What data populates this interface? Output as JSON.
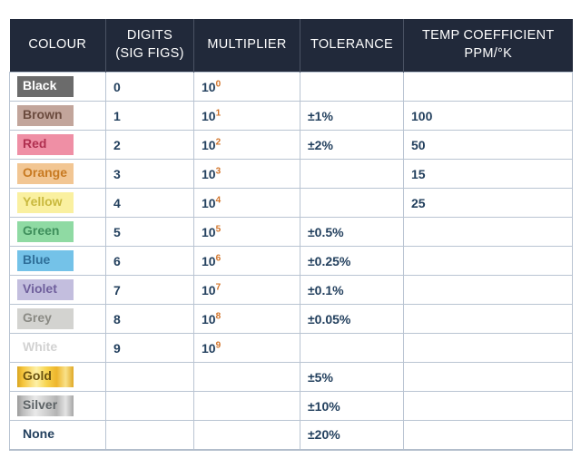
{
  "table": {
    "name": "resistor-colour-code-table",
    "headers": [
      {
        "line1": "COLOUR",
        "line2": ""
      },
      {
        "line1": "DIGITS",
        "line2": "(SIG FIGS)"
      },
      {
        "line1": "MULTIPLIER",
        "line2": ""
      },
      {
        "line1": "TOLERANCE",
        "line2": ""
      },
      {
        "line1": "TEMP COEFFICIENT",
        "line2": "PPM/°K"
      }
    ],
    "rows": [
      {
        "colour": "Black",
        "digits": "0",
        "mult_base": "10",
        "mult_exp": "0",
        "tolerance": "",
        "temp": "",
        "swatch_bg": "#6b6b6b",
        "swatch_fg": "#ffffff",
        "has_swatch": true
      },
      {
        "colour": "Brown",
        "digits": "1",
        "mult_base": "10",
        "mult_exp": "1",
        "tolerance": "±1%",
        "temp": "100",
        "swatch_bg": "#c2a59b",
        "swatch_fg": "#6b4b3e",
        "has_swatch": true
      },
      {
        "colour": "Red",
        "digits": "2",
        "mult_base": "10",
        "mult_exp": "2",
        "tolerance": "±2%",
        "temp": "50",
        "swatch_bg": "#ef8fa5",
        "swatch_fg": "#b03050",
        "has_swatch": true
      },
      {
        "colour": "Orange",
        "digits": "3",
        "mult_base": "10",
        "mult_exp": "3",
        "tolerance": "",
        "temp": "15",
        "swatch_bg": "#f2c693",
        "swatch_fg": "#c87a22",
        "has_swatch": true
      },
      {
        "colour": "Yellow",
        "digits": "4",
        "mult_base": "10",
        "mult_exp": "4",
        "tolerance": "",
        "temp": "25",
        "swatch_bg": "#faf0a0",
        "swatch_fg": "#c9b93f",
        "has_swatch": true
      },
      {
        "colour": "Green",
        "digits": "5",
        "mult_base": "10",
        "mult_exp": "5",
        "tolerance": "±0.5%",
        "temp": "",
        "swatch_bg": "#8fdaa3",
        "swatch_fg": "#3f8f5c",
        "has_swatch": true
      },
      {
        "colour": "Blue",
        "digits": "6",
        "mult_base": "10",
        "mult_exp": "6",
        "tolerance": "±0.25%",
        "temp": "",
        "swatch_bg": "#74c2e8",
        "swatch_fg": "#2f6f99",
        "has_swatch": true
      },
      {
        "colour": "Violet",
        "digits": "7",
        "mult_base": "10",
        "mult_exp": "7",
        "tolerance": "±0.1%",
        "temp": "",
        "swatch_bg": "#c3bede",
        "swatch_fg": "#6f5f9c",
        "has_swatch": true
      },
      {
        "colour": "Grey",
        "digits": "8",
        "mult_base": "10",
        "mult_exp": "8",
        "tolerance": "±0.05%",
        "temp": "",
        "swatch_bg": "#d3d3d0",
        "swatch_fg": "#8a8a84",
        "has_swatch": true
      },
      {
        "colour": "White",
        "digits": "9",
        "mult_base": "10",
        "mult_exp": "9",
        "tolerance": "",
        "temp": "",
        "swatch_bg": "#ffffff",
        "swatch_fg": "#d2d2d2",
        "has_swatch": false
      },
      {
        "colour": "Gold",
        "digits": "",
        "mult_base": "",
        "mult_exp": "",
        "tolerance": "±5%",
        "temp": "",
        "swatch_style": "gold",
        "has_swatch": true
      },
      {
        "colour": "Silver",
        "digits": "",
        "mult_base": "",
        "mult_exp": "",
        "tolerance": "±10%",
        "temp": "",
        "swatch_style": "silver",
        "has_swatch": true
      },
      {
        "colour": "None",
        "digits": "",
        "mult_base": "",
        "mult_exp": "",
        "tolerance": "±20%",
        "temp": "",
        "swatch_bg": "#ffffff",
        "swatch_fg": "#23405e",
        "has_swatch": false
      }
    ]
  },
  "colors": {
    "header_bg": "#21293a",
    "header_fg": "#ffffff",
    "grid_line": "#b9c4d2",
    "text": "#23405e",
    "exponent": "#d2742a",
    "page_bg": "#ffffff"
  }
}
